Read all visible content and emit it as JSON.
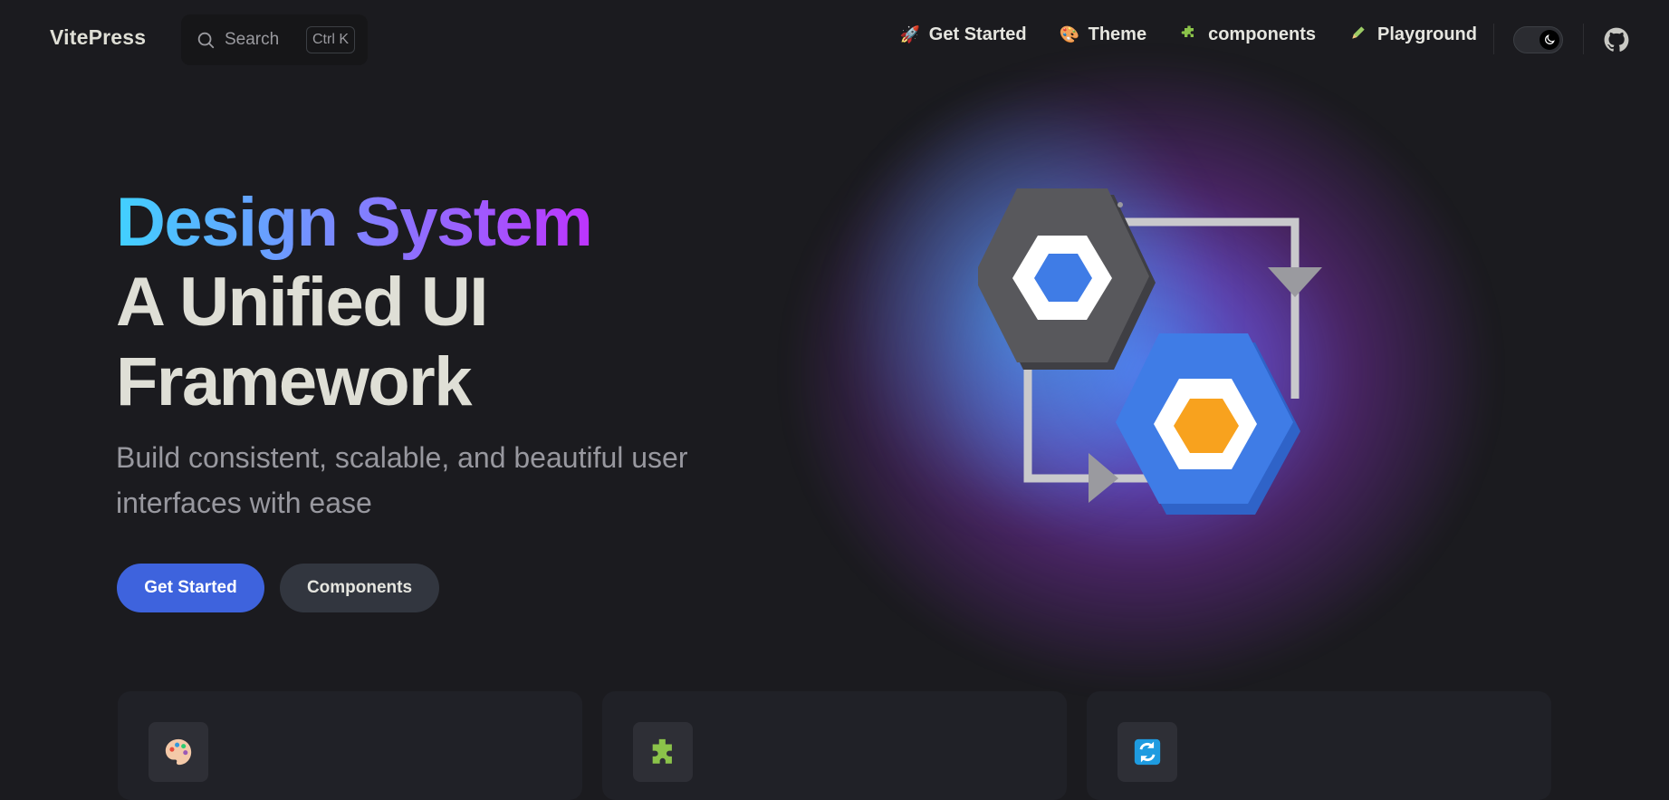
{
  "nav": {
    "brand": "VitePress",
    "search": {
      "label": "Search",
      "shortcut": "Ctrl K"
    },
    "links": [
      {
        "icon": "rocket-icon",
        "label": "Get Started"
      },
      {
        "icon": "palette-icon",
        "label": "Theme"
      },
      {
        "icon": "puzzle-icon",
        "label": "components"
      },
      {
        "icon": "pencil-icon",
        "label": "Playground"
      }
    ],
    "appearance_toggle": "dark",
    "github_icon": "github-icon"
  },
  "hero": {
    "name": "Design System",
    "title_line1": "A Unified UI",
    "title_line2": "Framework",
    "tagline_line1": "Build consistent, scalable, and beautiful user",
    "tagline_line2": "interfaces with ease",
    "actions": {
      "primary": "Get Started",
      "secondary": "Components"
    }
  },
  "features": [
    {
      "icon": "palette-icon"
    },
    {
      "icon": "puzzle-icon"
    },
    {
      "icon": "refresh-icon"
    }
  ],
  "colors": {
    "background": "#1b1b1f",
    "brand": "#3e63dd",
    "gradient_start": "#41d1ff",
    "gradient_end": "#bd34fe"
  }
}
